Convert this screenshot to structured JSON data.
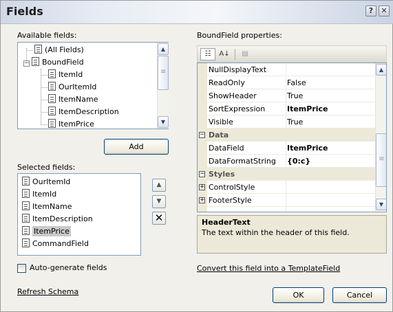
{
  "dialog": {
    "title": "Fields",
    "help_btn": "?",
    "close_btn": "✕"
  },
  "available": {
    "label": "Available fields:",
    "tree": [
      {
        "label": "(All Fields)"
      },
      {
        "label": "BoundField"
      },
      {
        "label": "ItemId"
      },
      {
        "label": "OurItemId"
      },
      {
        "label": "ItemName"
      },
      {
        "label": "ItemDescription"
      },
      {
        "label": "ItemPrice"
      }
    ],
    "add_button": "Add"
  },
  "selected": {
    "label": "Selected fields:",
    "items": [
      {
        "label": "OurItemId"
      },
      {
        "label": "ItemId"
      },
      {
        "label": "ItemName"
      },
      {
        "label": "ItemDescription"
      },
      {
        "label": "ItemPrice"
      },
      {
        "label": "CommandField"
      }
    ],
    "selected_index": 4
  },
  "properties": {
    "label": "BoundField properties:",
    "rows": [
      {
        "name": "NullDisplayText",
        "value": ""
      },
      {
        "name": "ReadOnly",
        "value": "False"
      },
      {
        "name": "ShowHeader",
        "value": "True"
      },
      {
        "name": "SortExpression",
        "value": "ItemPrice"
      },
      {
        "name": "Visible",
        "value": "True"
      }
    ],
    "categories": [
      {
        "name": "Data",
        "toggle": "−"
      },
      {
        "name": "Styles",
        "toggle": "−"
      }
    ],
    "data_rows": [
      {
        "name": "DataField",
        "value": "ItemPrice"
      },
      {
        "name": "DataFormatString",
        "value": "{0:c}"
      }
    ],
    "style_rows": [
      {
        "name": "ControlStyle",
        "toggle": "+"
      },
      {
        "name": "FooterStyle",
        "toggle": "+"
      }
    ],
    "help_title": "HeaderText",
    "help_text": "The text within the header of this field."
  },
  "footer": {
    "auto_generate": "Auto-generate fields",
    "refresh_schema": "Refresh Schema",
    "convert_link": "Convert this field into a TemplateField",
    "ok": "OK",
    "cancel": "Cancel"
  }
}
